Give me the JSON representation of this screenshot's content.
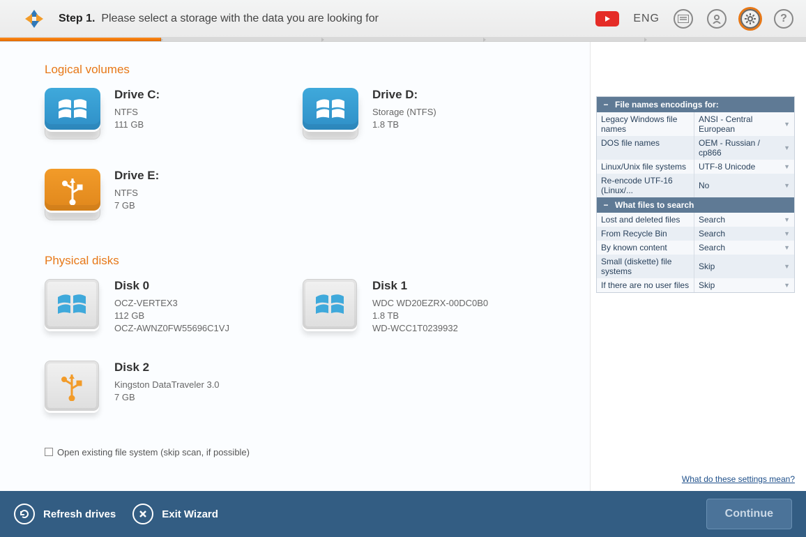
{
  "header": {
    "step_label": "Step 1.",
    "step_desc": "Please select a storage with the data you are looking for",
    "language": "ENG"
  },
  "sections": {
    "logical": "Logical volumes",
    "physical": "Physical disks"
  },
  "logical": [
    {
      "title": "Drive C:",
      "line1": "NTFS",
      "line2": "111 GB",
      "color": "blue",
      "sym": "win"
    },
    {
      "title": "Drive D:",
      "line1": "Storage (NTFS)",
      "line2": "1.8 TB",
      "color": "blue",
      "sym": "win"
    },
    {
      "title": "Drive E:",
      "line1": "NTFS",
      "line2": "7 GB",
      "color": "orange",
      "sym": "usb"
    }
  ],
  "physical": [
    {
      "title": "Disk 0",
      "line1": "OCZ-VERTEX3",
      "line2": "112 GB",
      "line3": "OCZ-AWNZ0FW55696C1VJ",
      "sym": "win"
    },
    {
      "title": "Disk 1",
      "line1": "WDC WD20EZRX-00DC0B0",
      "line2": "1.8 TB",
      "line3": "WD-WCC1T0239932",
      "sym": "win"
    },
    {
      "title": "Disk 2",
      "line1": "Kingston DataTraveler 3.0",
      "line2": "7 GB",
      "line3": "",
      "sym": "usb"
    }
  ],
  "open_existing": "Open existing file system (skip scan, if possible)",
  "panels": {
    "enc_header": "File names encodings for:",
    "search_header": "What files to search",
    "encodings": [
      {
        "l": "Legacy Windows file names",
        "r": "ANSI - Central European"
      },
      {
        "l": "DOS file names",
        "r": "OEM - Russian / cp866"
      },
      {
        "l": "Linux/Unix file systems",
        "r": "UTF-8 Unicode"
      },
      {
        "l": "Re-encode UTF-16 (Linux/...",
        "r": "No"
      }
    ],
    "search": [
      {
        "l": "Lost and deleted files",
        "r": "Search"
      },
      {
        "l": "From Recycle Bin",
        "r": "Search"
      },
      {
        "l": "By known content",
        "r": "Search"
      },
      {
        "l": "Small (diskette) file systems",
        "r": "Skip"
      },
      {
        "l": "If there are no user files",
        "r": "Skip"
      }
    ],
    "help_link": "What do these settings mean?"
  },
  "footer": {
    "refresh": "Refresh drives",
    "exit": "Exit Wizard",
    "continue": "Continue"
  }
}
